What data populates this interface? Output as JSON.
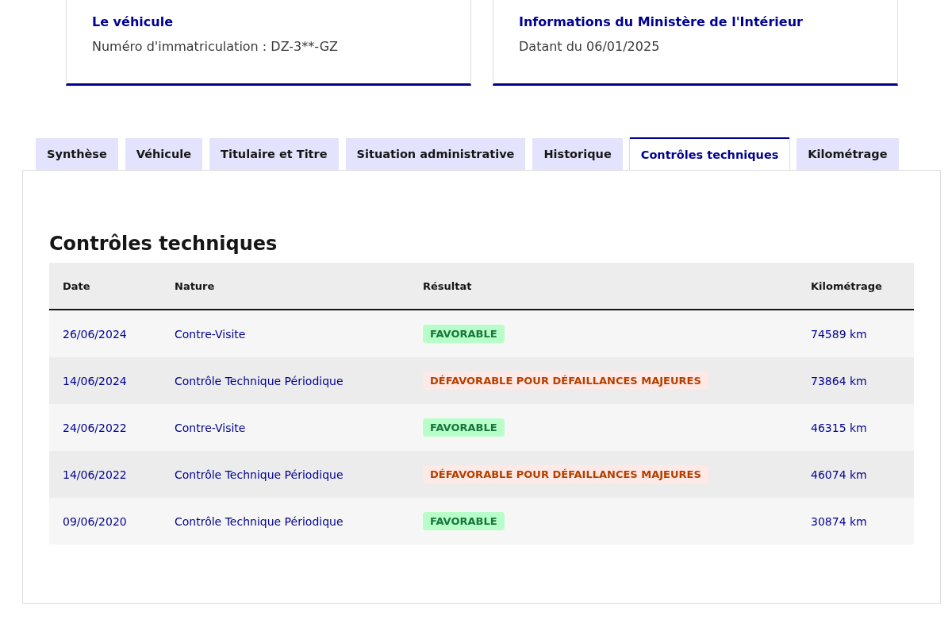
{
  "cards": [
    {
      "title": "Le véhicule",
      "text": "Numéro d'immatriculation : DZ-3**-GZ"
    },
    {
      "title": "Informations du Ministère de l'Intérieur",
      "text": "Datant du 06/01/2025"
    }
  ],
  "tabs": [
    {
      "label": "Synthèse",
      "selected": false
    },
    {
      "label": "Véhicule",
      "selected": false
    },
    {
      "label": "Titulaire et Titre",
      "selected": false
    },
    {
      "label": "Situation administrative",
      "selected": false
    },
    {
      "label": "Historique",
      "selected": false
    },
    {
      "label": "Contrôles techniques",
      "selected": true
    },
    {
      "label": "Kilométrage",
      "selected": false
    }
  ],
  "section_title": "Contrôles techniques",
  "table": {
    "columns": [
      "Date",
      "Nature",
      "Résultat",
      "Kilométrage"
    ],
    "rows": [
      {
        "date": "26/06/2024",
        "nature": "Contre-Visite",
        "result": {
          "kind": "success",
          "label": "FAVORABLE"
        },
        "km": "74589 km"
      },
      {
        "date": "14/06/2024",
        "nature": "Contrôle Technique Périodique",
        "result": {
          "kind": "error",
          "label": "DÉFAVORABLE POUR DÉFAILLANCES MAJEURES"
        },
        "km": "73864 km"
      },
      {
        "date": "24/06/2022",
        "nature": "Contre-Visite",
        "result": {
          "kind": "success",
          "label": "FAVORABLE"
        },
        "km": "46315 km"
      },
      {
        "date": "14/06/2022",
        "nature": "Contrôle Technique Périodique",
        "result": {
          "kind": "error",
          "label": "DÉFAVORABLE POUR DÉFAILLANCES MAJEURES"
        },
        "km": "46074 km"
      },
      {
        "date": "09/06/2020",
        "nature": "Contrôle Technique Périodique",
        "result": {
          "kind": "success",
          "label": "FAVORABLE"
        },
        "km": "30874 km"
      }
    ]
  }
}
